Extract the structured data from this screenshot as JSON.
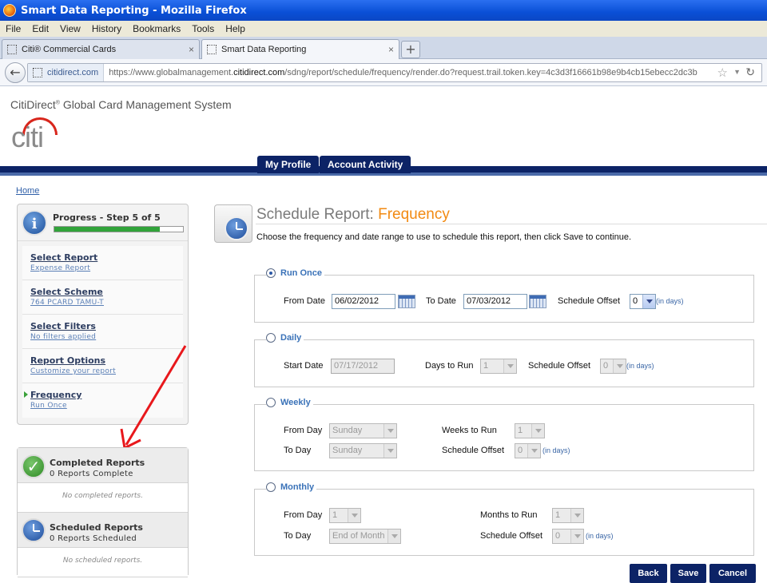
{
  "window": {
    "title": "Smart Data Reporting - Mozilla Firefox"
  },
  "menu": [
    "File",
    "Edit",
    "View",
    "History",
    "Bookmarks",
    "Tools",
    "Help"
  ],
  "tabs": [
    {
      "label": "Citi® Commercial Cards",
      "close": "×"
    },
    {
      "label": "Smart Data Reporting",
      "close": "×"
    }
  ],
  "newtab": "+",
  "address": {
    "site": "citidirect.com",
    "url_prefix": "https://www.globalmanagement.",
    "url_domain": "citidirect.com",
    "url_rest": "/sdng/report/schedule/frequency/render.do?request.trail.token.key=4c3d3f16661b98e9b4cb15ebecc2dc3b"
  },
  "header": {
    "brand": "CitiDirect",
    "brand_reg": "®",
    "brand_rest": " Global Card Management System",
    "logo_text": "citi"
  },
  "nav": {
    "my_profile": "My Profile",
    "account_activity": "Account Activity"
  },
  "breadcrumb": {
    "home": "Home"
  },
  "progress": {
    "title": "Progress - Step 5 of 5",
    "fraction": 0.82,
    "steps": [
      {
        "title": "Select Report",
        "sub": "Expense Report"
      },
      {
        "title": "Select Scheme",
        "sub": "764 PCARD TAMU-T"
      },
      {
        "title": "Select Filters",
        "sub": "No filters applied"
      },
      {
        "title": "Report Options",
        "sub": "Customize your report"
      },
      {
        "title": "Frequency",
        "sub": "Run Once"
      }
    ]
  },
  "completed": {
    "title": "Completed Reports",
    "sub": "0 Reports Complete",
    "empty": "No completed reports."
  },
  "scheduled": {
    "title": "Scheduled Reports",
    "sub": "0 Reports Scheduled",
    "empty": "No scheduled reports."
  },
  "main": {
    "title": "Schedule Report: ",
    "title_highlight": "Frequency",
    "intro": "Choose the frequency and date range to use to schedule this report, then click Save to continue."
  },
  "run_once": {
    "legend": "Run Once",
    "from_label": "From Date",
    "from_value": "06/02/2012",
    "to_label": "To Date",
    "to_value": "07/03/2012",
    "offset_label": "Schedule Offset",
    "offset_value": "0",
    "unit": "(in days)"
  },
  "daily": {
    "legend": "Daily",
    "start_label": "Start Date",
    "start_value": "07/17/2012",
    "days_label": "Days to Run",
    "days_value": "1",
    "offset_label": "Schedule Offset",
    "offset_value": "0",
    "unit": "(in days)"
  },
  "weekly": {
    "legend": "Weekly",
    "from_label": "From Day",
    "from_value": "Sunday",
    "to_label": "To Day",
    "to_value": "Sunday",
    "weeks_label": "Weeks to Run",
    "weeks_value": "1",
    "offset_label": "Schedule Offset",
    "offset_value": "0",
    "unit": "(in days)"
  },
  "monthly": {
    "legend": "Monthly",
    "from_label": "From Day",
    "from_value": "1",
    "to_label": "To Day",
    "to_value": "End of Month",
    "months_label": "Months to Run",
    "months_value": "1",
    "offset_label": "Schedule Offset",
    "offset_value": "0",
    "unit": "(in days)"
  },
  "actions": {
    "back": "Back",
    "save": "Save",
    "cancel": "Cancel"
  },
  "colors": {
    "nav": "#0c2366",
    "accent": "#f28a12",
    "link": "#2f5fa8",
    "progress_fill": "#31a33a",
    "annotation": "#e8181c"
  }
}
